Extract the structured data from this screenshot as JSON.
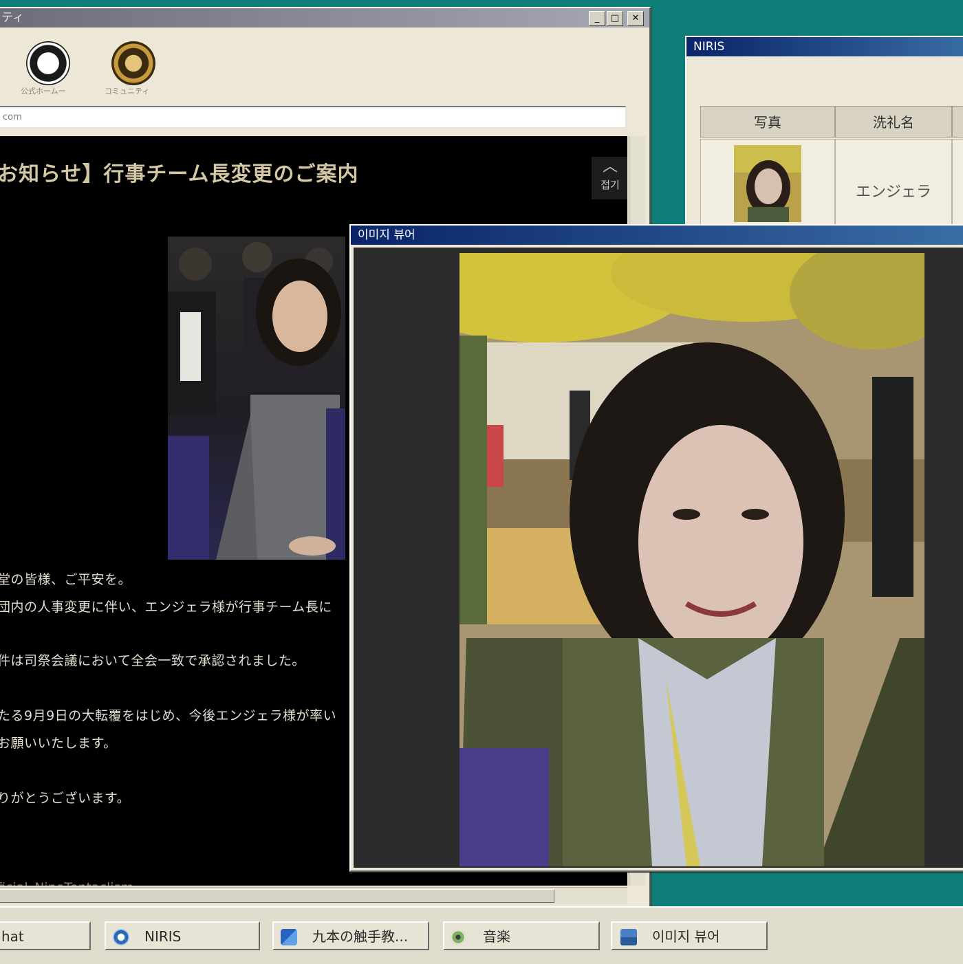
{
  "browser": {
    "title": "ティ",
    "toolbar": [
      {
        "label": "公式ホームー",
        "icon": "octopus-emblem-icon"
      },
      {
        "label": "コミュニティ",
        "icon": "crest-emblem-icon"
      }
    ],
    "address": "com",
    "post": {
      "title": "お知らせ】行事チーム長変更のご案内",
      "collapse_label": "접기",
      "lines": [
        "堂の皆様、ご平安を。",
        "団内の人事変更に伴い、エンジェラ様が行事チーム長に",
        "件は司祭会議において全会一致で承認されました。",
        "たる9月9日の大転覆をはじめ、今後エンジェラ様が率い",
        "お願いいたします。",
        "りがとうございます。"
      ],
      "footer": "ficial_NineTentaclism"
    }
  },
  "niris": {
    "title": "NIRIS",
    "columns": [
      "写真",
      "洗礼名"
    ],
    "rows": [
      {
        "name": "エンジェラ"
      }
    ]
  },
  "viewer": {
    "title": "이미지 뷰어"
  },
  "taskbar": {
    "items": [
      {
        "label": "hat",
        "icon": "chat-icon"
      },
      {
        "label": "NIRIS",
        "icon": "niris-app-icon"
      },
      {
        "label": "九本の触手教...",
        "icon": "browser-app-icon"
      },
      {
        "label": "音楽",
        "icon": "music-app-icon"
      },
      {
        "label": "이미지 뷰어",
        "icon": "image-viewer-app-icon"
      }
    ]
  },
  "colors": {
    "desktop": "#0f7d77",
    "title_active": "#0a246a",
    "post_title": "#d4c7a6"
  }
}
